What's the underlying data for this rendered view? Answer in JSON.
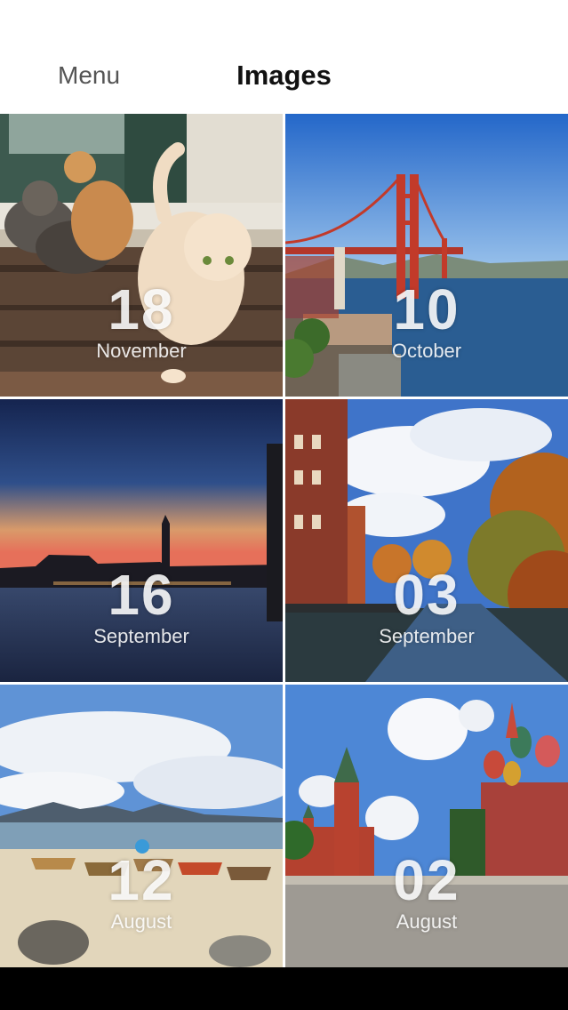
{
  "navbar": {
    "menu_label": "Menu",
    "title": "Images"
  },
  "tiles": [
    {
      "day": "18",
      "month": "November",
      "subject": "cats on a wooden step"
    },
    {
      "day": "10",
      "month": "October",
      "subject": "red suspension bridge over bay"
    },
    {
      "day": "16",
      "month": "September",
      "subject": "city silhouette at sunset over water"
    },
    {
      "day": "03",
      "month": "September",
      "subject": "canal with brick buildings and autumn trees"
    },
    {
      "day": "12",
      "month": "August",
      "subject": "beach with boats and mountains"
    },
    {
      "day": "02",
      "month": "August",
      "subject": "square with red tower and domed cathedral"
    }
  ],
  "colors": {
    "navbar_bg": "#ffffff",
    "menu_text": "#555555",
    "title_text": "#111111",
    "bottom_bar": "#000000"
  }
}
